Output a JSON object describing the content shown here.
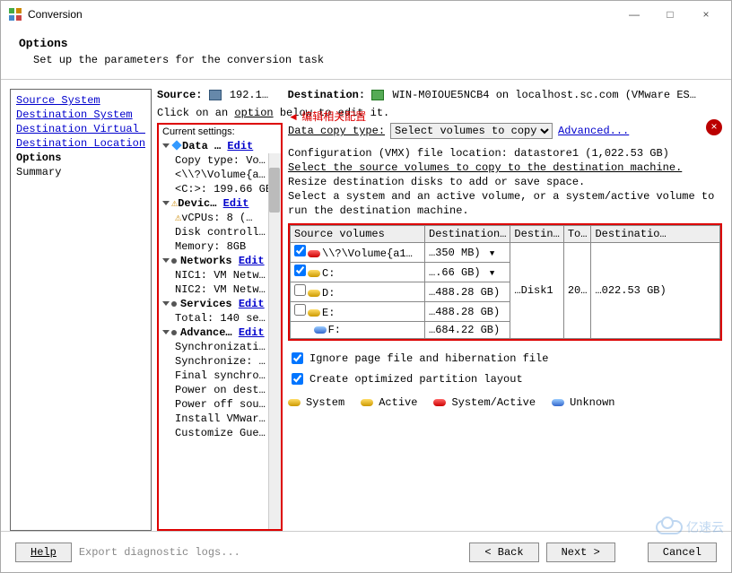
{
  "window": {
    "title": "Conversion",
    "minimize": "—",
    "maximize": "□",
    "close": "×"
  },
  "header": {
    "title": "Options",
    "subtitle": "Set up the parameters for the conversion task"
  },
  "nav": {
    "items": [
      {
        "label": "Source System",
        "link": true
      },
      {
        "label": "Destination System",
        "link": true
      },
      {
        "label": "Destination Virtual M",
        "link": true
      },
      {
        "label": "Destination Location",
        "link": true
      },
      {
        "label": "Options",
        "current": true
      },
      {
        "label": "Summary"
      }
    ]
  },
  "source_dest": {
    "source_label": "Source:",
    "source_value": "192.1…",
    "dest_label": "Destination:",
    "dest_value": "WIN-M0IOUE5NCB4 on localhost.sc.com (VMware ES…"
  },
  "instruction": {
    "pre": "Click on an ",
    "link": "option",
    "post": " below to edit it."
  },
  "annotation": "编辑相关配置",
  "tree": {
    "header": "Current settings:",
    "groups": [
      {
        "title": "Data …",
        "edit": "Edit",
        "children": [
          "Copy type: Vo…",
          "<\\\\?\\Volume{a…",
          "<C:>: 199.66 GB"
        ]
      },
      {
        "title": "Devic…",
        "edit": "Edit",
        "warn": true,
        "children": [
          "vCPUs: 8 (…",
          "Disk controll…",
          "Memory: 8GB"
        ],
        "child_warn": [
          true,
          false,
          false
        ]
      },
      {
        "title": "Networks",
        "edit": "Edit",
        "children": [
          "NIC1: VM Netw…",
          "NIC2: VM Netw…"
        ]
      },
      {
        "title": "Services",
        "edit": "Edit",
        "children": [
          "Total: 140 se…"
        ]
      },
      {
        "title": "Advance…",
        "edit": "Edit",
        "children": [
          "Synchronizati…",
          "Synchronize: …",
          "Final synchro…",
          "Power on dest…",
          "Power off sou…",
          "Install VMwar…",
          "Customize Gue…"
        ]
      }
    ]
  },
  "detail": {
    "copy_type_label": "Data copy type:",
    "copy_type_value": "Select volumes to copy",
    "advanced": "Advanced...",
    "config_line": "Configuration (VMX) file location: datastore1 (1,022.53 GB)",
    "help1": "Select the source volumes to copy to the destination machine.",
    "help2": "Resize destination disks to add or save space.",
    "help3": "Select a system and an active volume, or a system/active volume to run the destination machine.",
    "grid": {
      "headers": [
        "Source volumes",
        "Destination…",
        "Destin…",
        "To…",
        "Destinatio…"
      ],
      "rows": [
        {
          "checked": true,
          "disk": "red",
          "name": "\\\\?\\Volume{a1…",
          "dest_size": "…350 MB)",
          "dropdown": true
        },
        {
          "checked": true,
          "disk": "yellow",
          "name": "C:",
          "dest_size": "….66 GB)",
          "dropdown": true
        },
        {
          "checked": false,
          "disk": "yellow",
          "name": "D:",
          "dest_size": "…488.28 GB)"
        },
        {
          "checked": false,
          "disk": "yellow",
          "name": "E:",
          "dest_size": "…488.28 GB)"
        },
        {
          "checked": null,
          "disk": "blue",
          "name": "F:",
          "dest_size": "…684.22 GB)"
        }
      ],
      "disk_label": "…Disk1",
      "to_label": "20…",
      "dest_total": "…022.53 GB)"
    },
    "cb1": "Ignore page file and hibernation file",
    "cb2": "Create optimized partition layout",
    "legend": {
      "system": "System",
      "active": "Active",
      "sys_active": "System/Active",
      "unknown": "Unknown"
    }
  },
  "footer": {
    "help": "Help",
    "export": "Export diagnostic logs...",
    "back": "< Back",
    "next": "Next >",
    "cancel": "Cancel"
  },
  "watermark": "亿速云"
}
